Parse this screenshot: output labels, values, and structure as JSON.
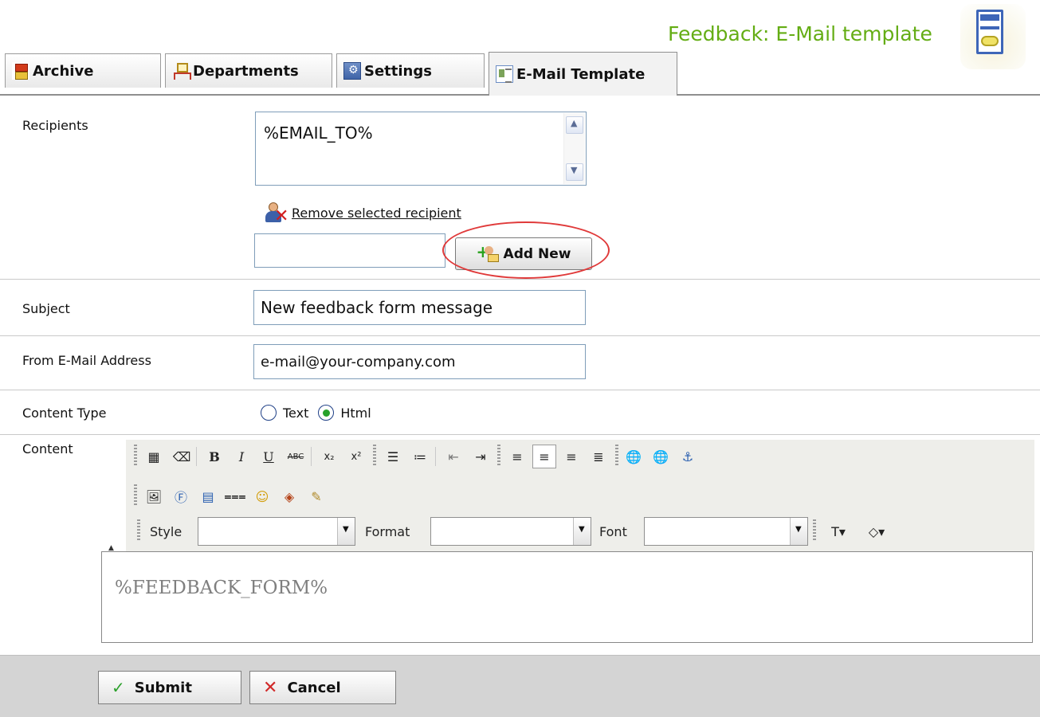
{
  "header": {
    "title": "Feedback: E-Mail template",
    "icon": "email-template-icon"
  },
  "tabs": [
    {
      "label": "Archive",
      "icon": "archive-icon"
    },
    {
      "label": "Departments",
      "icon": "departments-icon"
    },
    {
      "label": "Settings",
      "icon": "settings-icon"
    },
    {
      "label": "E-Mail Template",
      "icon": "email-template-tab-icon",
      "active": true
    }
  ],
  "form": {
    "recipients": {
      "label": "Recipients",
      "items": [
        "%EMAIL_TO%"
      ],
      "remove_label": "Remove selected recipient",
      "new_value": "",
      "add_label": "Add New"
    },
    "subject": {
      "label": "Subject",
      "value": "New feedback form message"
    },
    "from": {
      "label": "From E-Mail Address",
      "value": "e-mail@your-company.com"
    },
    "content_type": {
      "label": "Content Type",
      "options": [
        "Text",
        "Html"
      ],
      "selected": "Html"
    },
    "content": {
      "label": "Content",
      "style_label": "Style",
      "format_label": "Format",
      "font_label": "Font",
      "body": "%FEEDBACK_FORM%"
    }
  },
  "actions": {
    "submit_label": "Submit",
    "cancel_label": "Cancel"
  },
  "colors": {
    "title_green": "#64ad14",
    "highlight_ellipse": "#e03a3a",
    "footer_bg": "#d4d4d4"
  }
}
